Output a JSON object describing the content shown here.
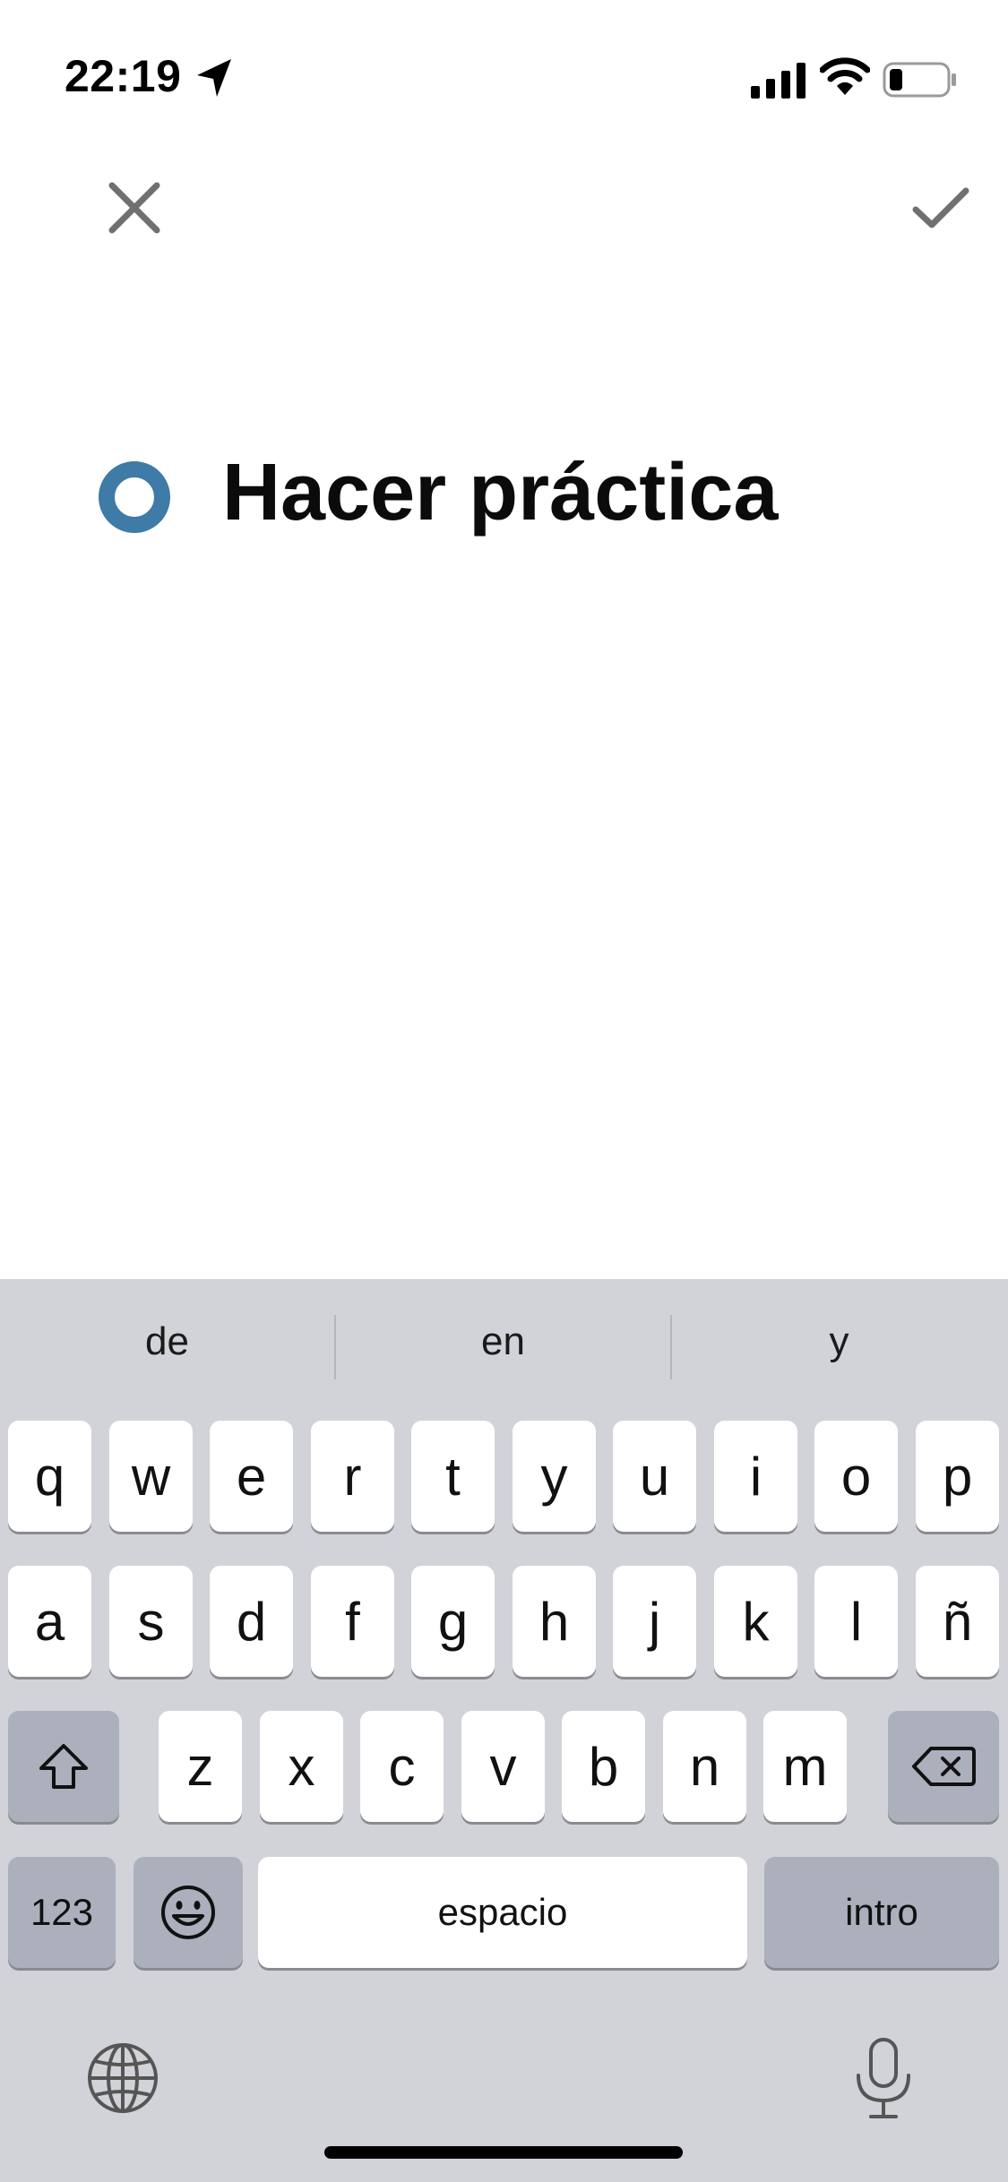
{
  "status_bar": {
    "time": "22:19",
    "icons": [
      "location-arrow-icon",
      "cellular-signal-icon",
      "wifi-icon",
      "battery-icon"
    ],
    "battery_level": 0.2
  },
  "nav": {
    "close_icon": "close-icon",
    "confirm_icon": "checkmark-icon"
  },
  "task": {
    "title": "Hacer práctica",
    "radio_color": "#3e7ba6"
  },
  "keyboard": {
    "suggestions": [
      "de",
      "en",
      "y"
    ],
    "rows": [
      [
        "q",
        "w",
        "e",
        "r",
        "t",
        "y",
        "u",
        "i",
        "o",
        "p"
      ],
      [
        "a",
        "s",
        "d",
        "f",
        "g",
        "h",
        "j",
        "k",
        "l",
        "ñ"
      ],
      [
        "z",
        "x",
        "c",
        "v",
        "b",
        "n",
        "m"
      ]
    ],
    "shift_icon": "shift-icon",
    "delete_icon": "delete-backspace-icon",
    "numbers_label": "123",
    "emoji_icon": "emoji-icon",
    "space_label": "espacio",
    "return_label": "intro",
    "globe_icon": "globe-icon",
    "mic_icon": "microphone-icon"
  }
}
